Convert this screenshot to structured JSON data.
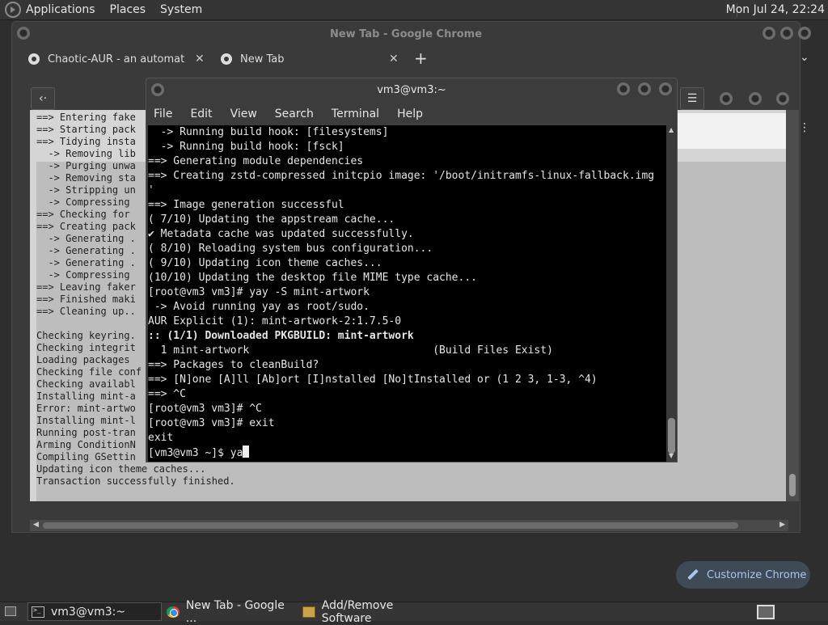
{
  "top_panel": {
    "menus": [
      "Applications",
      "Places",
      "System"
    ],
    "clock": "Mon Jul 24, 22:24"
  },
  "chrome": {
    "window_title": "New Tab - Google Chrome",
    "tabs": [
      {
        "label": "Chaotic-AUR - an automated |"
      },
      {
        "label": "New Tab"
      }
    ],
    "new_tab_symbol": "+",
    "tab_list_symbol": "⌄",
    "customize_label": "Customize Chrome"
  },
  "installer_log": {
    "lines": [
      "==> Entering fake",
      "==> Starting pack",
      "==> Tidying insta",
      "  -> Removing lib",
      "  -> Purging unwa",
      "  -> Removing sta",
      "  -> Stripping un",
      "  -> Compressing ",
      "==> Checking for ",
      "==> Creating pack",
      "  -> Generating .",
      "  -> Generating .",
      "  -> Generating .",
      "  -> Compressing ",
      "==> Leaving faker",
      "==> Finished maki",
      "==> Cleaning up..",
      "",
      "Checking keyring.",
      "Checking integrit",
      "Loading packages ",
      "Checking file conf",
      "Checking availabl",
      "Installing mint-a",
      "Error: mint-artwo",
      "Installing mint-l",
      "Running post-tran",
      "Arming ConditionN",
      "Compiling GSettin",
      "Updating icon theme caches...",
      "Transaction successfully finished."
    ]
  },
  "terminal": {
    "title": "vm3@vm3:~",
    "menu": [
      "File",
      "Edit",
      "View",
      "Search",
      "Terminal",
      "Help"
    ],
    "lines": [
      "  -> Running build hook: [filesystems]",
      "  -> Running build hook: [fsck]",
      "==> Generating module dependencies",
      "==> Creating zstd-compressed initcpio image: '/boot/initramfs-linux-fallback.img",
      "'",
      "==> Image generation successful",
      "( 7/10) Updating the appstream cache...",
      "✔ Metadata cache was updated successfully.",
      "( 8/10) Reloading system bus configuration...",
      "( 9/10) Updating icon theme caches...",
      "(10/10) Updating the desktop file MIME type cache...",
      "[root@vm3 vm3]# yay -S mint-artwork",
      " -> Avoid running yay as root/sudo.",
      "AUR Explicit (1): mint-artwork-2:1.7.5-0",
      ":: (1/1) Downloaded PKGBUILD: mint-artwork",
      "  1 mint-artwork                             (Build Files Exist)",
      "==> Packages to cleanBuild?",
      "==> [N]one [A]ll [Ab]ort [I]nstalled [No]tInstalled or (1 2 3, 1-3, ^4)",
      "==> ^C",
      "[root@vm3 vm3]# ^C",
      "[root@vm3 vm3]# exit",
      "exit",
      "[vm3@vm3 ~]$ ya"
    ]
  },
  "taskbar": {
    "items": [
      {
        "label": "vm3@vm3:~"
      },
      {
        "label": "New Tab - Google ..."
      },
      {
        "label": "Add/Remove Software"
      }
    ]
  }
}
